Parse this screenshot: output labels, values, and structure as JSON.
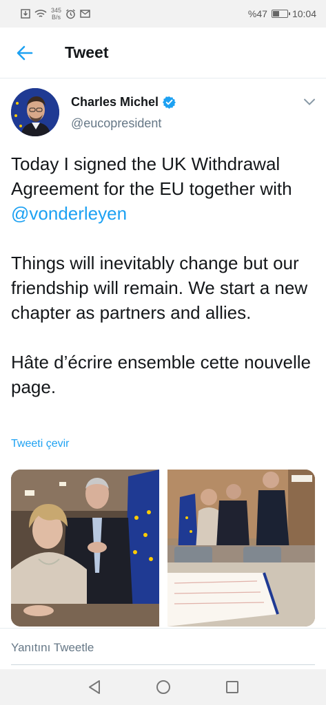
{
  "status_bar": {
    "speed_value": "345",
    "speed_unit": "B/s",
    "battery_text": "%47",
    "battery_level": 0.47,
    "time": "10:04",
    "icons": [
      "download-icon",
      "wifi-icon",
      "alarm-icon",
      "mail-icon",
      "battery-icon"
    ]
  },
  "header": {
    "title": "Tweet",
    "back_icon": "arrow-left-icon"
  },
  "tweet": {
    "author_name": "Charles Michel",
    "verified": true,
    "author_handle": "@eucopresident",
    "paragraph1": "Today I signed the UK Withdrawal Agreement for the EU together with ",
    "mention": "@vonderleyen",
    "paragraph2": "Things will inevitably change but our friendship will remain. We start a new chapter as partners and allies.",
    "paragraph3": "Hâte d’écrire ensemble cette nouvelle page.",
    "translate_label": "Tweeti çevir",
    "more_icon": "chevron-down-icon"
  },
  "reply": {
    "placeholder": "Yanıtını Tweetle"
  },
  "nav": {
    "icons": [
      "back-triangle-icon",
      "home-circle-icon",
      "recents-square-icon"
    ]
  },
  "colors": {
    "accent": "#1da1f2",
    "text": "#14171a",
    "secondary": "#657786",
    "eu_blue": "#1f3a93",
    "eu_star": "#ffcc00"
  }
}
